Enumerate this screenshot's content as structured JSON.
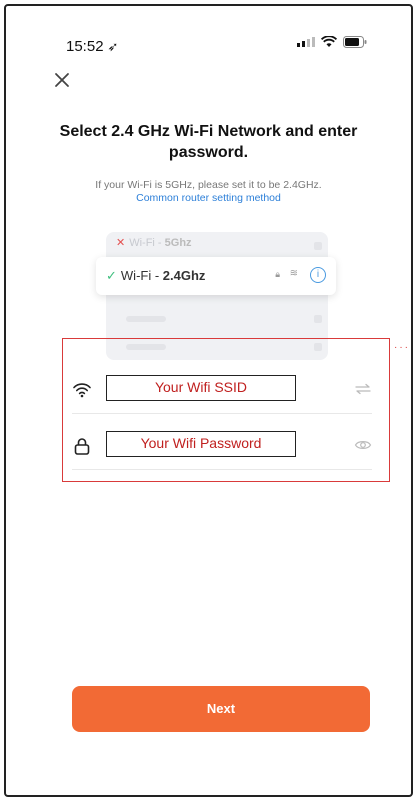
{
  "status_bar": {
    "time": "15:52",
    "location_arrow": "➶"
  },
  "header": {
    "close_icon": "close-icon"
  },
  "title": "Select 2.4 GHz Wi-Fi Network and enter password.",
  "subtitle": "If your Wi-Fi is 5GHz, please set it to be 2.4GHz.",
  "link_text": "Common router setting method",
  "illustration": {
    "wifi5_prefix": "Wi-Fi - ",
    "wifi5_band": "5Ghz",
    "wifi24_prefix": "Wi-Fi - ",
    "wifi24_band": "2.4Ghz"
  },
  "form": {
    "ssid_value": "Your Wifi SSID",
    "password_value": "Your Wifi Password"
  },
  "actions": {
    "next_label": "Next"
  },
  "colors": {
    "accent": "#f26a35",
    "link": "#2c7fd8",
    "annotation": "#d93a3a"
  }
}
